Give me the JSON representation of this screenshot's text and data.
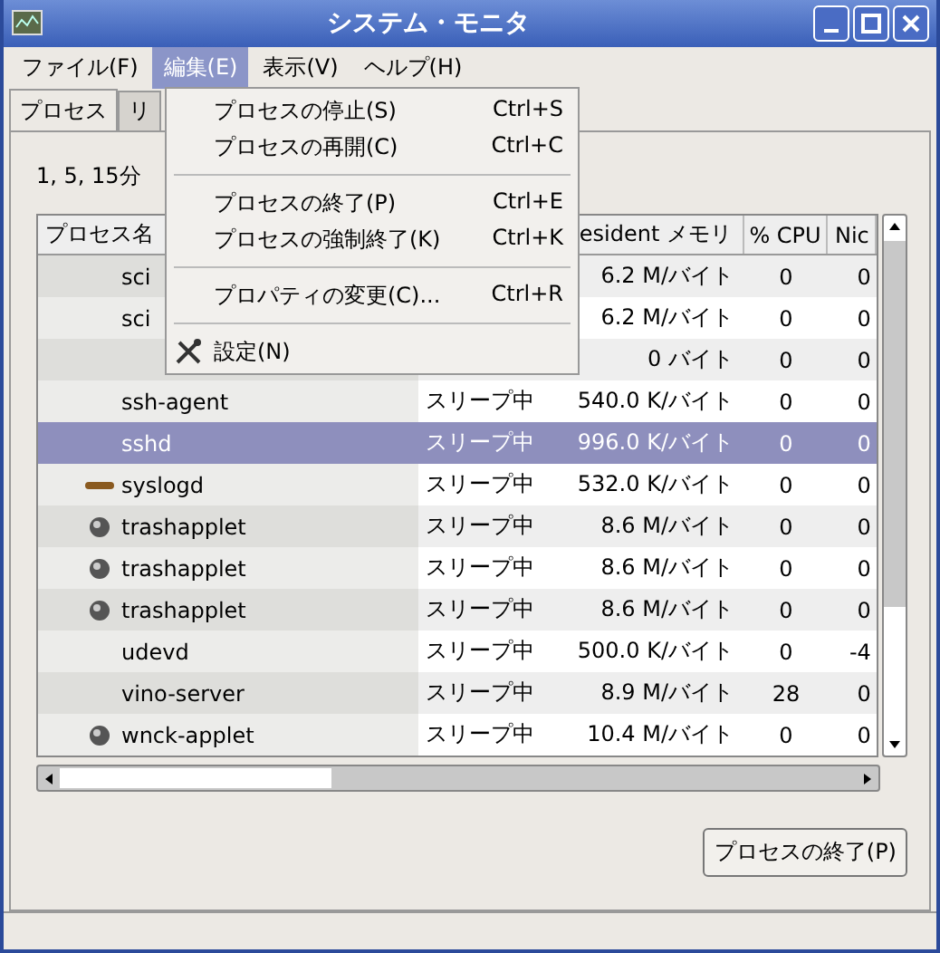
{
  "window": {
    "title": "システム・モニタ"
  },
  "menubar": [
    {
      "label": "ファイル(F)",
      "selected": false
    },
    {
      "label": "編集(E)",
      "selected": true
    },
    {
      "label": "表示(V)",
      "selected": false
    },
    {
      "label": "ヘルプ(H)",
      "selected": false
    }
  ],
  "tabs": [
    {
      "label": "プロセス",
      "selected": true
    },
    {
      "label": "リ",
      "selected": false
    }
  ],
  "load_label": "1, 5, 15分",
  "table": {
    "columns": [
      "プロセス名",
      "esident メモリ",
      "% CPU",
      "Nic"
    ],
    "rows": [
      {
        "name": "sci",
        "memory": "6.2 M/バイト",
        "cpu": "0",
        "nice": "0",
        "kind": "plain",
        "selected": false
      },
      {
        "name": "sci",
        "memory": "6.2 M/バイト",
        "cpu": "0",
        "nice": "0",
        "kind": "plain",
        "selected": false
      },
      {
        "memory": "0 バイト",
        "cpu": "0",
        "nice": "0",
        "kind": "plain",
        "selected": false
      },
      {
        "name": "ssh-agent",
        "status": "スリープ中",
        "memory": "540.0 K/バイト",
        "cpu": "0",
        "nice": "0",
        "kind": "plain",
        "selected": false
      },
      {
        "name": "sshd",
        "status": "スリープ中",
        "memory": "996.0 K/バイト",
        "cpu": "0",
        "nice": "0",
        "kind": "plain",
        "selected": true
      },
      {
        "name": "syslogd",
        "status": "スリープ中",
        "memory": "532.0 K/バイト",
        "cpu": "0",
        "nice": "0",
        "kind": "log",
        "selected": false
      },
      {
        "name": "trashapplet",
        "status": "スリープ中",
        "memory": "8.6 M/バイト",
        "cpu": "0",
        "nice": "0",
        "kind": "sphere",
        "selected": false
      },
      {
        "name": "trashapplet",
        "status": "スリープ中",
        "memory": "8.6 M/バイト",
        "cpu": "0",
        "nice": "0",
        "kind": "sphere",
        "selected": false
      },
      {
        "name": "trashapplet",
        "status": "スリープ中",
        "memory": "8.6 M/バイト",
        "cpu": "0",
        "nice": "0",
        "kind": "sphere",
        "selected": false
      },
      {
        "name": "udevd",
        "status": "スリープ中",
        "memory": "500.0 K/バイト",
        "cpu": "0",
        "nice": "-4",
        "kind": "plain",
        "selected": false
      },
      {
        "name": "vino-server",
        "status": "スリープ中",
        "memory": "8.9 M/バイト",
        "cpu": "28",
        "nice": "0",
        "kind": "plain",
        "selected": false
      },
      {
        "name": "wnck-applet",
        "status": "スリープ中",
        "memory": "10.4 M/バイト",
        "cpu": "0",
        "nice": "0",
        "kind": "sphere",
        "selected": false
      }
    ]
  },
  "edit_menu": [
    {
      "kind": "item",
      "label": "プロセスの停止(S)",
      "shortcut": "Ctrl+S"
    },
    {
      "kind": "item",
      "label": "プロセスの再開(C)",
      "shortcut": "Ctrl+C"
    },
    {
      "kind": "separator"
    },
    {
      "kind": "item",
      "label": "プロセスの終了(P)",
      "shortcut": "Ctrl+E"
    },
    {
      "kind": "item",
      "label": "プロセスの強制終了(K)",
      "shortcut": "Ctrl+K"
    },
    {
      "kind": "separator"
    },
    {
      "kind": "item",
      "label": "プロパティの変更(C)...",
      "shortcut": "Ctrl+R"
    },
    {
      "kind": "separator"
    },
    {
      "kind": "tool_item",
      "label": "設定(N)"
    }
  ],
  "end_button": "プロセスの終了(P)"
}
